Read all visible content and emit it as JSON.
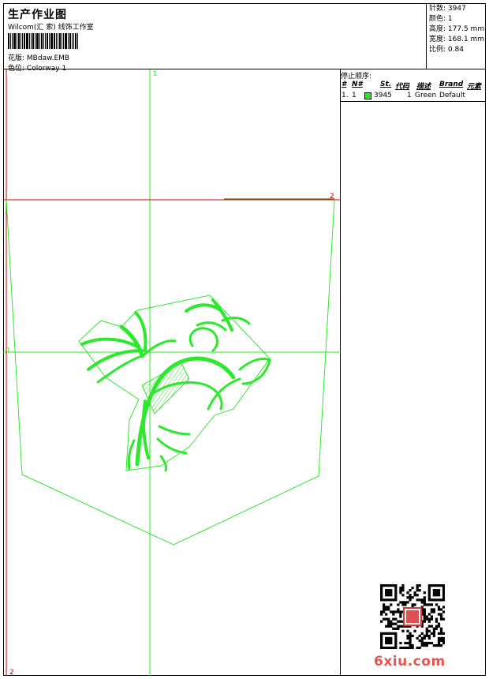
{
  "header": {
    "title": "生产作业图",
    "company": "Wilcom(汇 索) 线饰工作室",
    "file_label": "花版:",
    "file_name": "MBdaw.EMB",
    "colorway_label": "色位:",
    "colorway_name": "Colorway 1"
  },
  "stats": [
    {
      "label": "针数:",
      "value": "3947"
    },
    {
      "label": "颜色:",
      "value": "1"
    },
    {
      "label": "高度:",
      "value": "177.5 mm"
    },
    {
      "label": "宽度:",
      "value": "168.1 mm"
    },
    {
      "label": "比例:",
      "value": "0.84"
    }
  ],
  "stop_sequence": {
    "title": "停止顺序:",
    "columns": [
      "#",
      "N#",
      "St.",
      "代码",
      "描述",
      "Brand",
      "元素"
    ],
    "rows": [
      {
        "index": "1.",
        "needle": "1",
        "stitches": "3945",
        "code": "1",
        "description": "Green",
        "brand": "Default",
        "color": "#2ee82e"
      }
    ]
  },
  "guides": {
    "v1_label": "1",
    "h2_label": "2",
    "h1_label": "1",
    "v2_label": "2"
  },
  "colors": {
    "thread": "#2ee82e",
    "guide_red": "#c00000",
    "watermark": "#e4574f"
  },
  "watermark": {
    "text": "6xiu.com",
    "seal": "汇索印"
  }
}
